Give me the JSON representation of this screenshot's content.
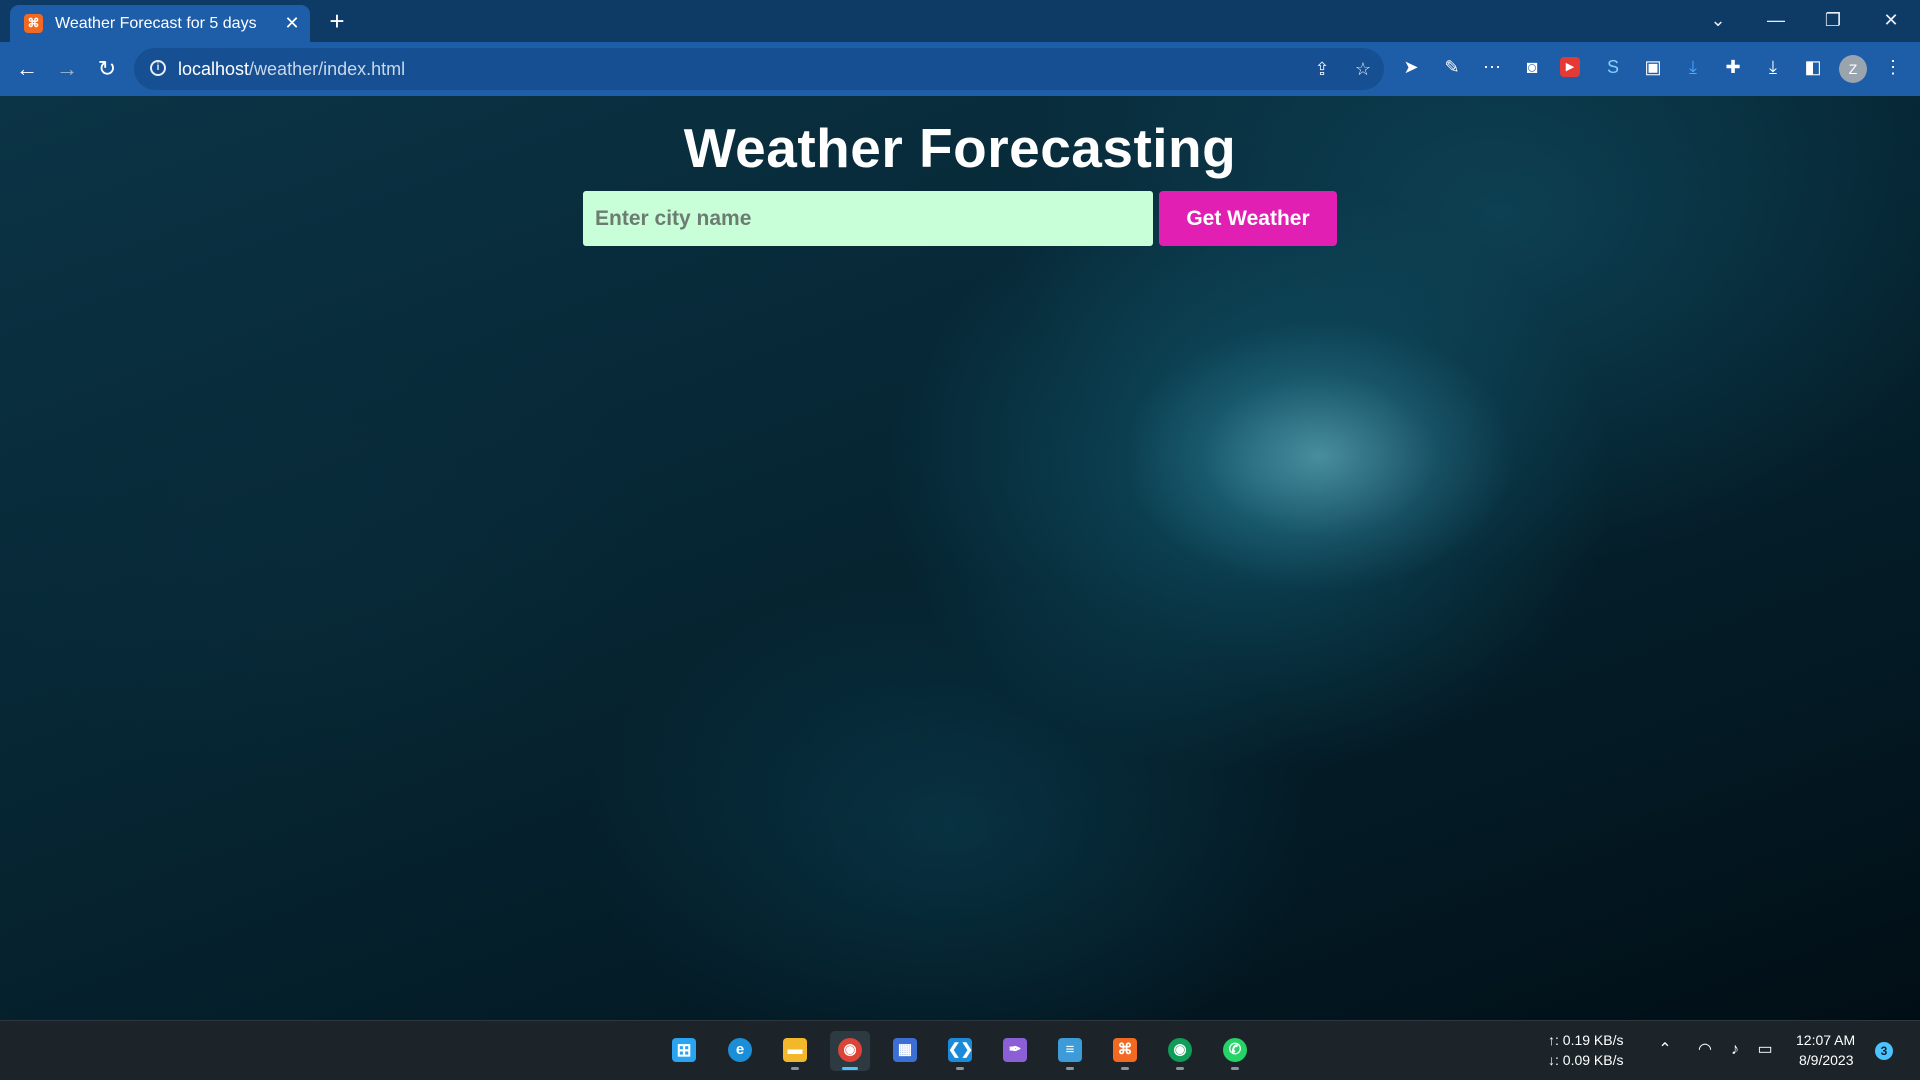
{
  "browser": {
    "tab": {
      "title": "Weather Forecast for 5 days",
      "favicon": "xampp-icon"
    },
    "url_host": "localhost",
    "url_path": "/weather/index.html",
    "profile_initial": "Z",
    "colors": {
      "tabbar": "#0e3a66",
      "toolbar": "#1e5da8"
    }
  },
  "page": {
    "title": "Weather Forecasting",
    "city_input": {
      "value": "",
      "placeholder": "Enter city name"
    },
    "button_label": "Get Weather",
    "colors": {
      "input_bg": "#c8ffd8",
      "button_bg": "#e11fb3"
    }
  },
  "taskbar": {
    "network": {
      "upload": "↑: 0.19 KB/s",
      "download": "↓: 0.09 KB/s"
    },
    "time": "12:07 AM",
    "date": "8/9/2023",
    "notification_count": "3",
    "apps": [
      "windows-start-icon",
      "edge-icon",
      "file-explorer-icon",
      "chrome-icon",
      "microsoft-store-icon",
      "vscode-icon",
      "feather-app-icon",
      "notepad-icon",
      "xampp-icon",
      "chrome-alt-icon",
      "whatsapp-icon"
    ]
  }
}
